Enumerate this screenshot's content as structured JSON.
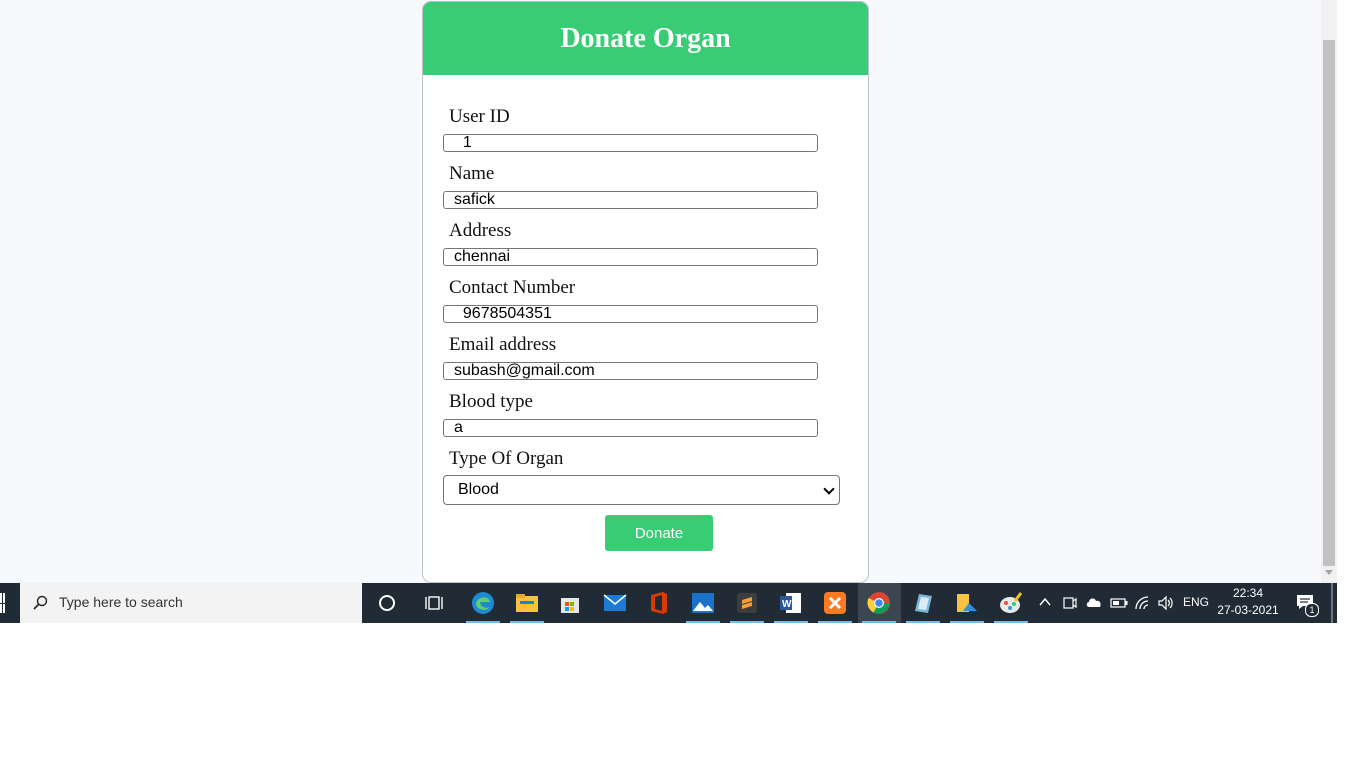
{
  "form": {
    "title": "Donate Organ",
    "fields": [
      {
        "label": "User ID",
        "value": "  1"
      },
      {
        "label": "Name",
        "value": "safick"
      },
      {
        "label": "Address",
        "value": "chennai"
      },
      {
        "label": "Contact Number",
        "value": "  9678504351"
      },
      {
        "label": "Email address",
        "value": "subash@gmail.com"
      },
      {
        "label": "Blood type",
        "value": "a"
      }
    ],
    "organ_label": "Type Of Organ",
    "organ_selected": "Blood",
    "submit_label": "Donate"
  },
  "taskbar": {
    "search_placeholder": "Type here to search",
    "language": "ENG",
    "time": "22:34",
    "date": "27-03-2021",
    "notification_count": "1",
    "pinned_apps": [
      "cortana-icon",
      "task-view-icon",
      "edge-icon",
      "file-explorer-icon",
      "store-icon",
      "mail-icon",
      "office-icon",
      "photos-icon",
      "sublime-text-icon",
      "word-icon",
      "xampp-icon",
      "chrome-icon",
      "notepad-icon",
      "file-manager-icon",
      "paint-icon"
    ]
  },
  "colors": {
    "accent": "#38cc74",
    "page_bg": "#f7f9fd",
    "taskbar_bg": "#202b36"
  }
}
